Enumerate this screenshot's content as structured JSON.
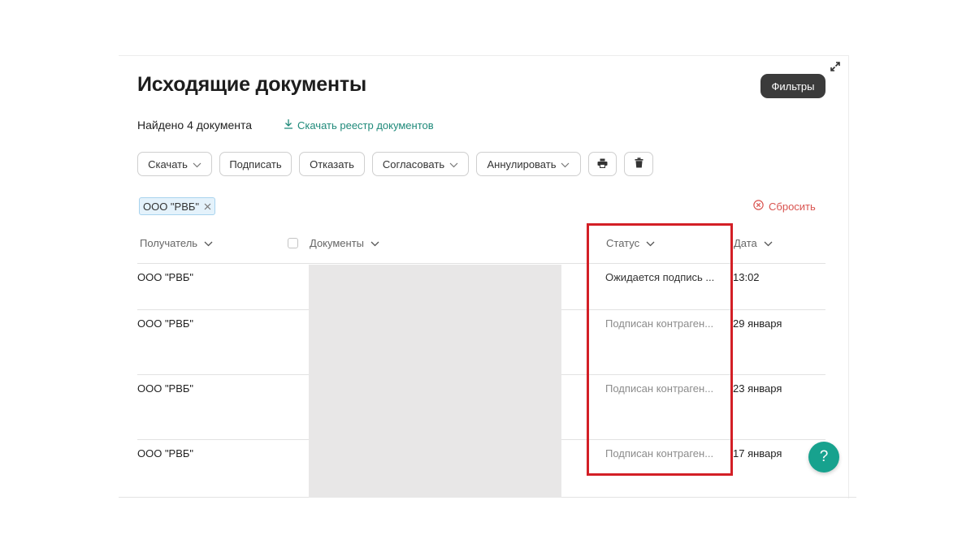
{
  "page": {
    "title": "Исходящие документы",
    "filters_button": "Фильтры",
    "found_count": "Найдено 4 документа",
    "download_registry": "Скачать реестр документов"
  },
  "toolbar": {
    "download": "Скачать",
    "sign": "Подписать",
    "reject": "Отказать",
    "approve": "Согласовать",
    "annul": "Аннулировать"
  },
  "active_filter": {
    "chip_label": "ООО \"РВБ\"",
    "reset_label": "Сбросить"
  },
  "table": {
    "columns": {
      "recipient": "Получатель",
      "documents": "Документы",
      "status": "Статус",
      "date": "Дата"
    },
    "rows": [
      {
        "recipient": "ООО \"РВБ\"",
        "status": "Ожидается подпись ...",
        "date": "13:02"
      },
      {
        "recipient": "ООО \"РВБ\"",
        "status": "Подписан контраген...",
        "date": "29 января"
      },
      {
        "recipient": "ООО \"РВБ\"",
        "status": "Подписан контраген...",
        "date": "23 января"
      },
      {
        "recipient": "ООО \"РВБ\"",
        "status": "Подписан контраген...",
        "date": "17 января"
      }
    ]
  },
  "help_button": "?",
  "colors": {
    "accent": "#1f8a7a",
    "help_button": "#17a28e",
    "highlight": "#d31f26",
    "reset": "#d9534f",
    "chip_bg": "#e4f2fb"
  },
  "icons": {
    "expand": "expand-icon",
    "download": "download-icon",
    "chevron": "chevron-down-icon",
    "print": "printer-icon",
    "delete": "trash-icon",
    "chip_close": "close-icon",
    "reset": "close-circle-icon"
  }
}
